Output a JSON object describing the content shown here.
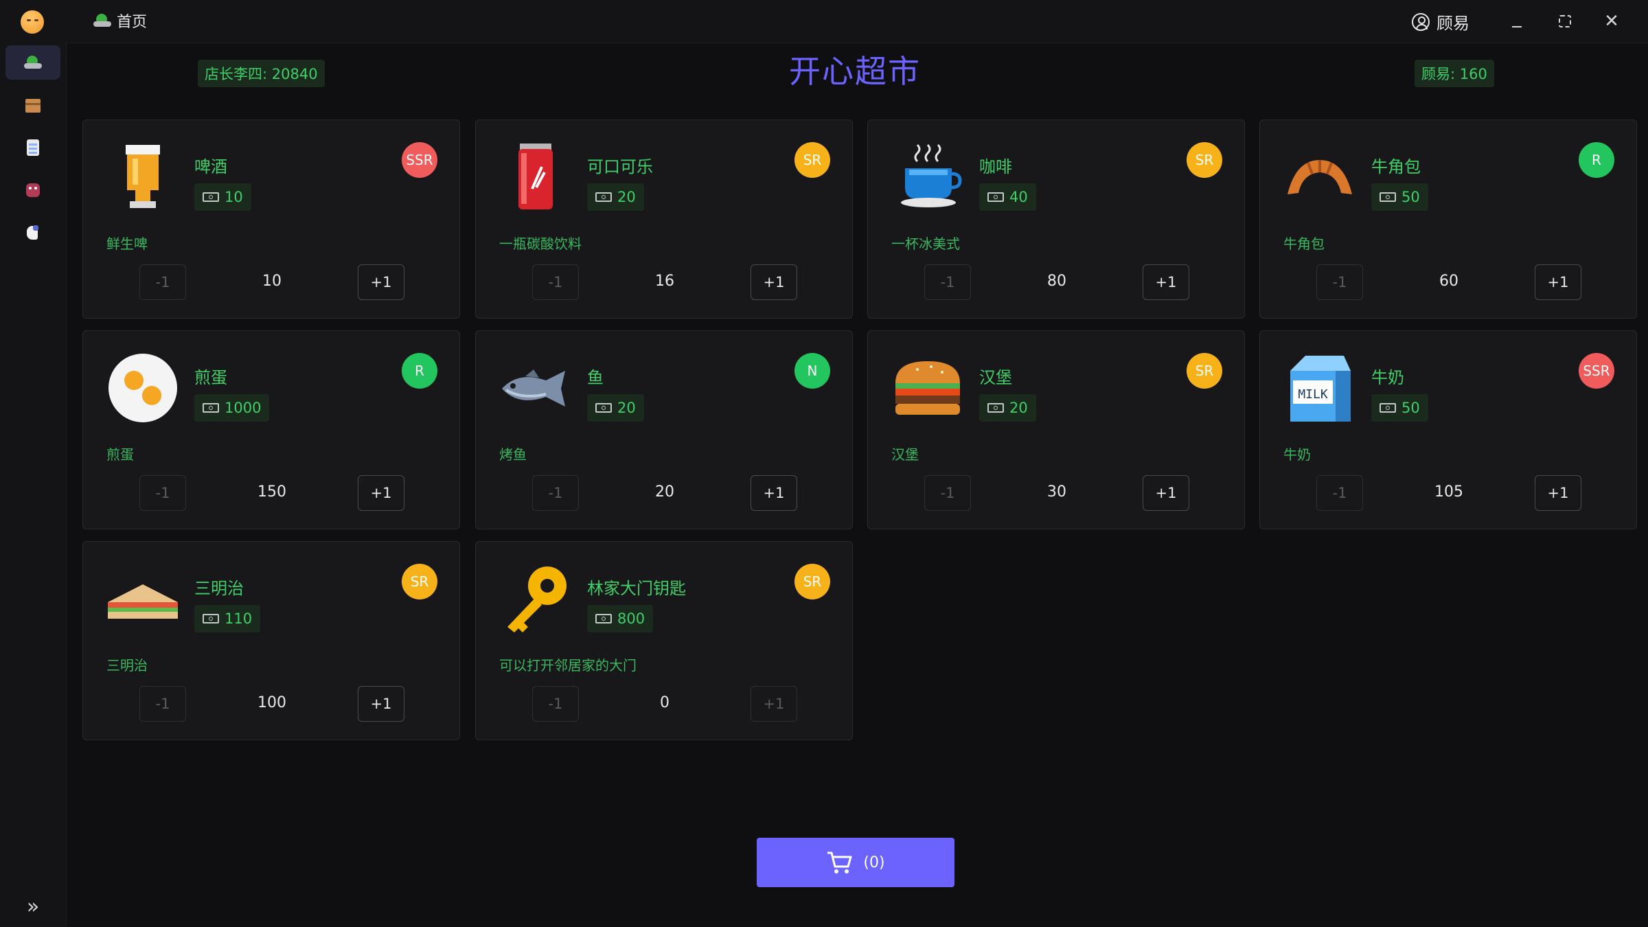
{
  "titlebar": {
    "home_tab_label": "首页",
    "user_name": "顾易",
    "close_glyph": "✕"
  },
  "header": {
    "shopkeeper": "店长李四: 20840",
    "store_title": "开心超市",
    "customer": "顾易: 160"
  },
  "sidebar": {
    "items": [
      {
        "icon": "island-icon",
        "active": true
      },
      {
        "icon": "box-icon",
        "active": false
      },
      {
        "icon": "notepad-icon",
        "active": false
      },
      {
        "icon": "monster-icon",
        "active": false
      },
      {
        "icon": "horse-icon",
        "active": false
      }
    ],
    "expand_glyph": "»"
  },
  "products": [
    {
      "name": "啤酒",
      "price": "10",
      "rarity": "SSR",
      "desc": "鲜生啤",
      "qty": "10",
      "image": "beer",
      "minus": "-1",
      "plus": "+1"
    },
    {
      "name": "可口可乐",
      "price": "20",
      "rarity": "SR",
      "desc": "一瓶碳酸饮料",
      "qty": "16",
      "image": "cola",
      "minus": "-1",
      "plus": "+1"
    },
    {
      "name": "咖啡",
      "price": "40",
      "rarity": "SR",
      "desc": "一杯冰美式",
      "qty": "80",
      "image": "coffee",
      "minus": "-1",
      "plus": "+1"
    },
    {
      "name": "牛角包",
      "price": "50",
      "rarity": "R",
      "desc": "牛角包",
      "qty": "60",
      "image": "croissant",
      "minus": "-1",
      "plus": "+1"
    },
    {
      "name": "煎蛋",
      "price": "1000",
      "rarity": "R",
      "desc": "煎蛋",
      "qty": "150",
      "image": "egg",
      "minus": "-1",
      "plus": "+1"
    },
    {
      "name": "鱼",
      "price": "20",
      "rarity": "N",
      "desc": "烤鱼",
      "qty": "20",
      "image": "fish",
      "minus": "-1",
      "plus": "+1"
    },
    {
      "name": "汉堡",
      "price": "20",
      "rarity": "SR",
      "desc": "汉堡",
      "qty": "30",
      "image": "burger",
      "minus": "-1",
      "plus": "+1"
    },
    {
      "name": "牛奶",
      "price": "50",
      "rarity": "SSR",
      "desc": "牛奶",
      "qty": "105",
      "image": "milk",
      "minus": "-1",
      "plus": "+1"
    },
    {
      "name": "三明治",
      "price": "110",
      "rarity": "SR",
      "desc": "三明治",
      "qty": "100",
      "image": "sandwich",
      "minus": "-1",
      "plus": "+1"
    },
    {
      "name": "林家大门钥匙",
      "price": "800",
      "rarity": "SR",
      "desc": "可以打开邻居家的大门",
      "qty": "0",
      "image": "key",
      "minus": "-1",
      "plus": "+1"
    }
  ],
  "cart": {
    "count_label": "(0)"
  },
  "colors": {
    "accent": "#6c63ff",
    "green_text": "#3fcf69",
    "rarity_ssr": "#f05c5c",
    "rarity_sr": "#f7b21a",
    "rarity_r": "#22c55e",
    "rarity_n": "#22c55e"
  }
}
